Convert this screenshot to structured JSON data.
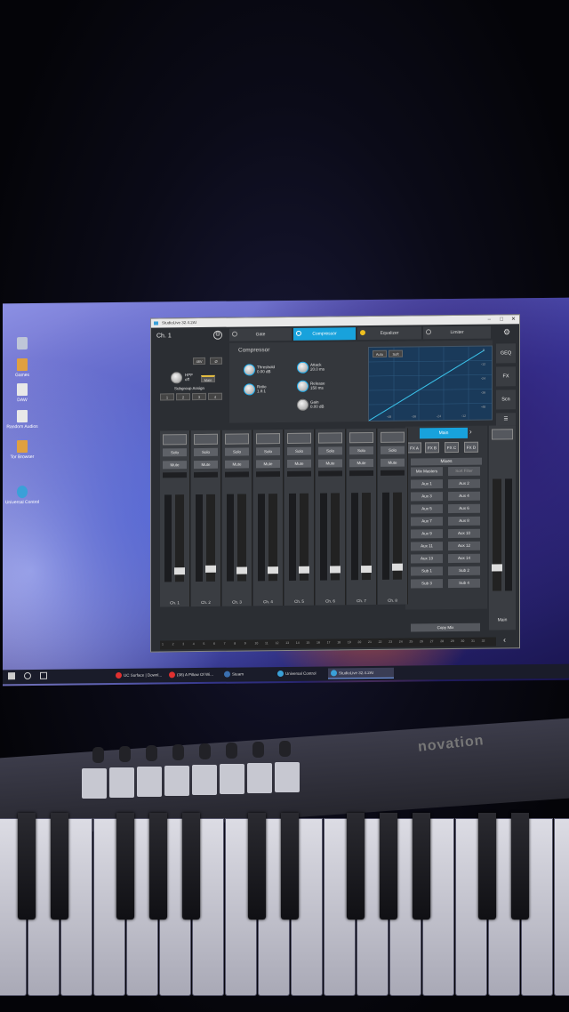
{
  "desktop": {
    "icons": [
      {
        "label": "",
        "icon": "recycle-bin-icon"
      },
      {
        "label": "Games",
        "icon": "folder-icon"
      },
      {
        "label": "DAW",
        "icon": "file-icon"
      },
      {
        "label": "Random Audios",
        "icon": "file-icon"
      },
      {
        "label": "Tor Browser",
        "icon": "folder-icon"
      },
      {
        "label": "Universal Control",
        "icon": "universal-control-icon"
      }
    ]
  },
  "taskbar": {
    "items": [
      {
        "label": "UC Surface | Downl..."
      },
      {
        "label": "(38) A Pillow Of Wi..."
      },
      {
        "label": "Steam"
      },
      {
        "label": "Universal Control"
      },
      {
        "label": "StudioLive 32.4.2AI"
      }
    ]
  },
  "app": {
    "title": "StudioLive 32.4.2AI",
    "channel": "Ch. 1",
    "tabs": [
      "Gate",
      "Compressor",
      "Equalizer",
      "Limiter"
    ],
    "active_tab": "Compressor",
    "side": [
      "GEQ",
      "FX",
      "Scn"
    ],
    "phantom": "48V",
    "phase": "Ø",
    "hpf_label": "HPF",
    "hpf_value": "off",
    "main_label": "Main",
    "subgroup_title": "Subgroup Assign",
    "subgroups": [
      "1",
      "2",
      "3",
      "4"
    ],
    "comp": {
      "title": "Compressor",
      "threshold_label": "Threshold",
      "threshold_value": "0.00 dB",
      "ratio_label": "Ratio",
      "ratio_value": "1.8:1",
      "attack_label": "Attack",
      "attack_value": "20.0 ms",
      "release_label": "Release",
      "release_value": "150 ms",
      "gain_label": "Gain",
      "gain_value": "0.00 dB",
      "auto": "Auto",
      "soft": "Soft"
    },
    "graph_ticks_y": [
      "0",
      "-12",
      "-24",
      "-36",
      "-48",
      "-60"
    ],
    "graph_ticks_x": [
      "-48",
      "-36",
      "-24",
      "-12"
    ],
    "strips": [
      {
        "name": "Ch. 1"
      },
      {
        "name": "Ch. 2"
      },
      {
        "name": "Ch. 3"
      },
      {
        "name": "Ch. 4"
      },
      {
        "name": "Ch. 5"
      },
      {
        "name": "Ch. 6"
      },
      {
        "name": "Ch. 7"
      },
      {
        "name": "Ch. 8"
      }
    ],
    "solo": "Solo",
    "mute": "Mute",
    "main_button": "Main",
    "fx_buttons": [
      "FX A",
      "FX B",
      "FX C",
      "FX D"
    ],
    "mixes_title": "Mixes",
    "mix_masters": "Mix Masters",
    "sort_filter": "Sort Filter",
    "mix_buttons": [
      "Aux 1",
      "Aux 2",
      "Aux 3",
      "Aux 4",
      "Aux 5",
      "Aux 6",
      "Aux 7",
      "Aux 8",
      "Aux 9",
      "Aux 10",
      "Aux 11",
      "Aux 12",
      "Aux 13",
      "Aux 14",
      "Sub 1",
      "Sub 2",
      "Sub 3",
      "Sub 4"
    ],
    "copy_mix": "Copy Mix",
    "main_strip": "Main",
    "ruler": [
      "1",
      "2",
      "3",
      "4",
      "5",
      "6",
      "7",
      "8",
      "9",
      "10",
      "11",
      "12",
      "13",
      "14",
      "15",
      "16",
      "17",
      "18",
      "19",
      "20",
      "21",
      "22",
      "23",
      "24",
      "25",
      "26",
      "27",
      "28",
      "29",
      "30",
      "31",
      "32"
    ]
  },
  "keyboard": {
    "brand": "novation"
  }
}
